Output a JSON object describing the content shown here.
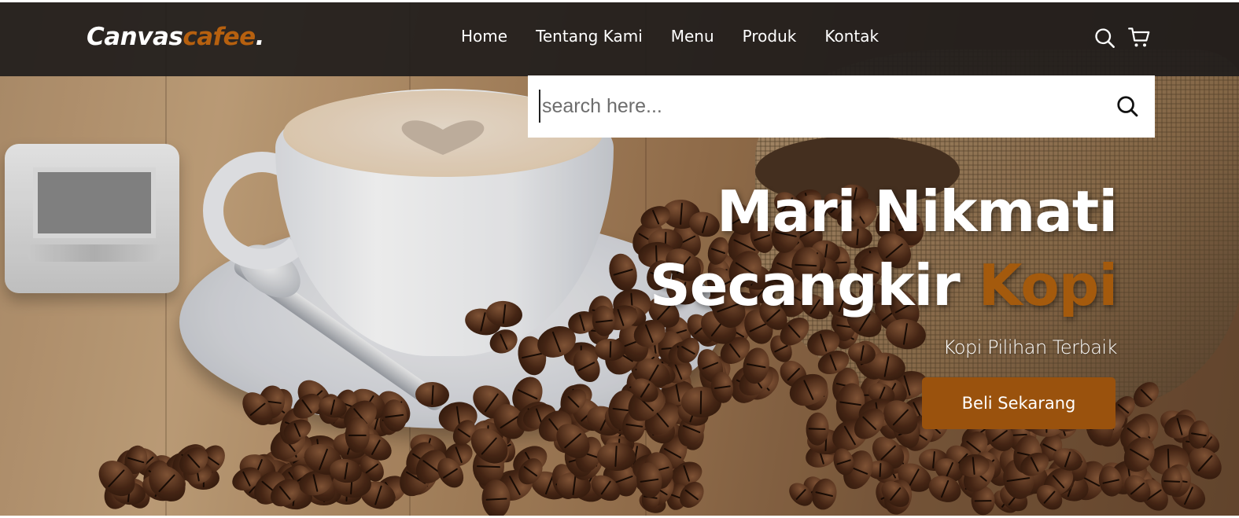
{
  "brand": {
    "name_main": "Canvas",
    "name_accent": "cafee",
    "name_dot": "."
  },
  "nav": {
    "items": [
      {
        "label": "Home"
      },
      {
        "label": "Tentang Kami"
      },
      {
        "label": "Menu"
      },
      {
        "label": "Produk"
      },
      {
        "label": "Kontak"
      }
    ],
    "icons": [
      "search-icon",
      "cart-icon"
    ]
  },
  "search": {
    "placeholder": "search here...",
    "value": "",
    "submit_icon": "search-icon"
  },
  "hero": {
    "headline_line1": "Mari Nikmati",
    "headline_line2_white": "Secangkir",
    "headline_line2_accent": "Kopi",
    "subtitle": "Kopi Pilihan Terbaik",
    "cta_label": "Beli Sekarang"
  },
  "colors": {
    "navbar_bg": "#201c1b",
    "accent": "#b6600f",
    "button_bg": "#9a520d",
    "text_light": "#ffffff"
  }
}
